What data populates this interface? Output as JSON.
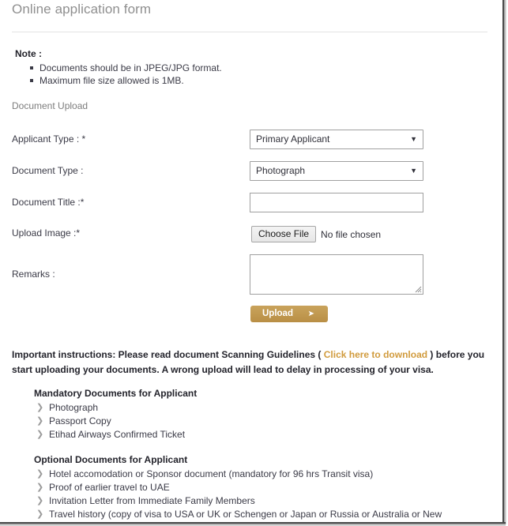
{
  "page": {
    "title": "Online application form"
  },
  "note": {
    "heading": "Note :",
    "items": [
      "Documents should be in JPEG/JPG format.",
      "Maximum file size allowed is 1MB."
    ]
  },
  "form": {
    "section_heading": "Document Upload",
    "applicant_type": {
      "label": "Applicant Type : *",
      "value": "Primary Applicant",
      "caret": "▼"
    },
    "document_type": {
      "label": "Document Type :",
      "value": "Photograph",
      "caret": "▼"
    },
    "document_title": {
      "label": "Document Title :*",
      "value": "",
      "placeholder": ""
    },
    "upload_image": {
      "label": "Upload Image :*",
      "choose_button": "Choose File",
      "file_status": "No file chosen"
    },
    "remarks": {
      "label": "Remarks :",
      "value": "",
      "placeholder": ""
    },
    "upload_button": {
      "label": "Upload",
      "arrow": "➤",
      "color": "#c09a55"
    }
  },
  "instructions": {
    "before_link": "Important instructions: Please read document Scanning Guidelines ( ",
    "link_text": "Click here to download",
    "after_link": " ) before you start uploading your documents. A wrong upload will lead to delay in processing of your visa.",
    "link_color": "#d19b3d"
  },
  "documents": {
    "mandatory": {
      "title": "Mandatory Documents for Applicant",
      "items": [
        "Photograph",
        "Passport Copy",
        "Etihad Airways Confirmed Ticket"
      ]
    },
    "optional": {
      "title": "Optional Documents for Applicant",
      "items": [
        "Hotel accomodation or Sponsor document (mandatory for 96 hrs Transit visa)",
        "Proof of earlier travel to UAE",
        "Invitation Letter from Immediate Family Members",
        "Travel history (copy of visa to USA or UK or Schengen or Japan or Russia or Australia or New"
      ]
    },
    "chevron": "❯"
  }
}
